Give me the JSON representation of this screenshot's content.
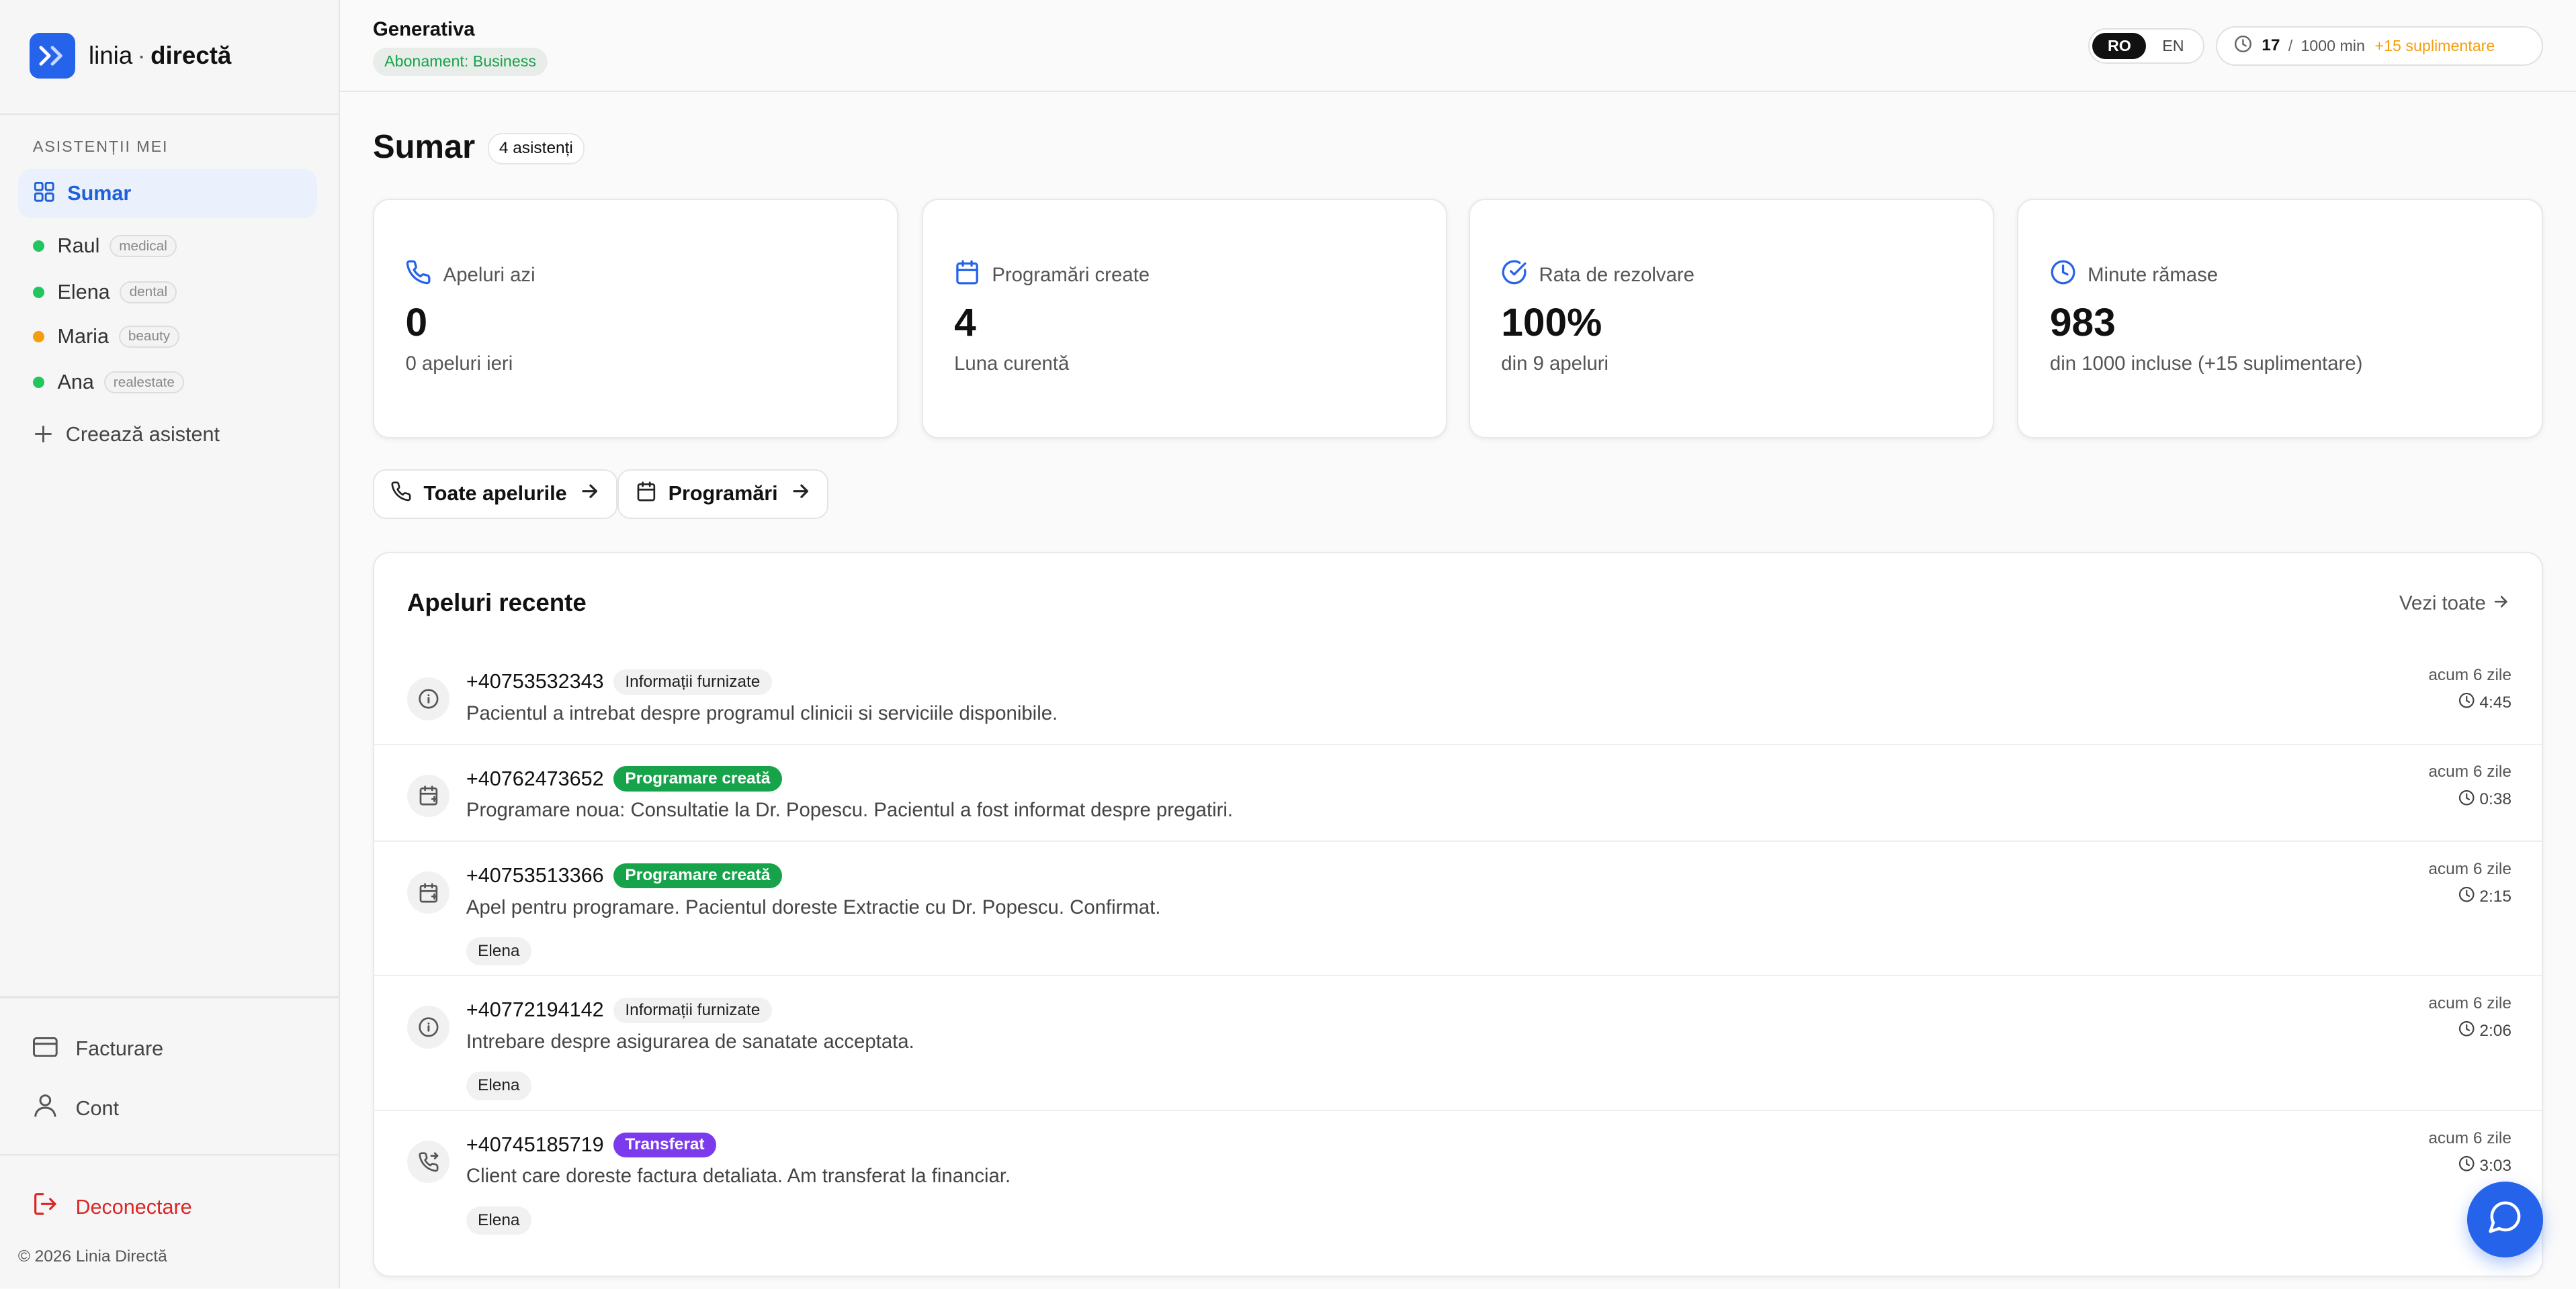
{
  "brand": {
    "name_left": "linia",
    "name_right": "directă"
  },
  "sidebar": {
    "section_label": "ASISTENȚII MEI",
    "active_item": "Sumar",
    "assistants": [
      {
        "name": "Raul",
        "tag": "medical",
        "status_color": "#22c55e"
      },
      {
        "name": "Elena",
        "tag": "dental",
        "status_color": "#22c55e"
      },
      {
        "name": "Maria",
        "tag": "beauty",
        "status_color": "#f59e0b"
      },
      {
        "name": "Ana",
        "tag": "realestate",
        "status_color": "#22c55e"
      }
    ],
    "create_label": "Creează asistent",
    "billing_label": "Facturare",
    "account_label": "Cont",
    "logout_label": "Deconectare",
    "copyright": "© 2026 Linia Directă"
  },
  "header": {
    "org_name": "Generativa",
    "subscription": "Abonament: Business",
    "lang_options": [
      "RO",
      "EN"
    ],
    "lang_active": "RO",
    "minutes_used": "17",
    "minutes_sep": "/",
    "minutes_total": "1000 min",
    "minutes_extra": "+15 suplimentare"
  },
  "main": {
    "title": "Sumar",
    "count_badge": "4 asistenți",
    "stats": [
      {
        "label": "Apeluri azi",
        "value": "0",
        "sub": "0 apeluri ieri",
        "icon": "phone-icon"
      },
      {
        "label": "Programări create",
        "value": "4",
        "sub": "Luna curentă",
        "icon": "calendar-icon"
      },
      {
        "label": "Rata de rezolvare",
        "value": "100%",
        "sub": "din 9 apeluri",
        "icon": "check-circle-icon"
      },
      {
        "label": "Minute rămase",
        "value": "983",
        "sub": "din 1000 incluse (+15 suplimentare)",
        "icon": "clock-icon"
      }
    ],
    "quick_links": [
      {
        "label": "Toate apelurile",
        "icon": "phone-icon"
      },
      {
        "label": "Programări",
        "icon": "calendar-icon"
      }
    ],
    "recent": {
      "title": "Apeluri recente",
      "see_all": "Vezi toate",
      "calls": [
        {
          "phone": "+40753532343",
          "tag": "Informații furnizate",
          "desc": "Pacientul a intrebat despre programul clinicii si serviciile disponibile.",
          "assistant": "",
          "time": "acum 6 zile",
          "duration": "4:45",
          "icon": "info-icon"
        },
        {
          "phone": "+40762473652",
          "tag": "Programare creată",
          "desc": "Programare noua: Consultatie la Dr. Popescu. Pacientul a fost informat despre pregatiri.",
          "assistant": "",
          "time": "acum 6 zile",
          "duration": "0:38",
          "icon": "calendar-plus-icon"
        },
        {
          "phone": "+40753513366",
          "tag": "Programare creată",
          "desc": "Apel pentru programare. Pacientul doreste Extractie cu Dr. Popescu. Confirmat.",
          "assistant": "Elena",
          "time": "acum 6 zile",
          "duration": "2:15",
          "icon": "calendar-plus-icon"
        },
        {
          "phone": "+40772194142",
          "tag": "Informații furnizate",
          "desc": "Intrebare despre asigurarea de sanatate acceptata.",
          "assistant": "Elena",
          "time": "acum 6 zile",
          "duration": "2:06",
          "icon": "info-icon"
        },
        {
          "phone": "+40745185719",
          "tag": "Transferat",
          "desc": "Client care doreste factura detaliata. Am transferat la financiar.",
          "assistant": "Elena",
          "time": "acum 6 zile",
          "duration": "3:03",
          "icon": "phone-forward-icon"
        }
      ]
    }
  },
  "colors": {
    "accent": "#2563eb",
    "success": "#16a34a",
    "transfer": "#7c3aed",
    "warning": "#f59e0b",
    "danger": "#dc2626"
  }
}
